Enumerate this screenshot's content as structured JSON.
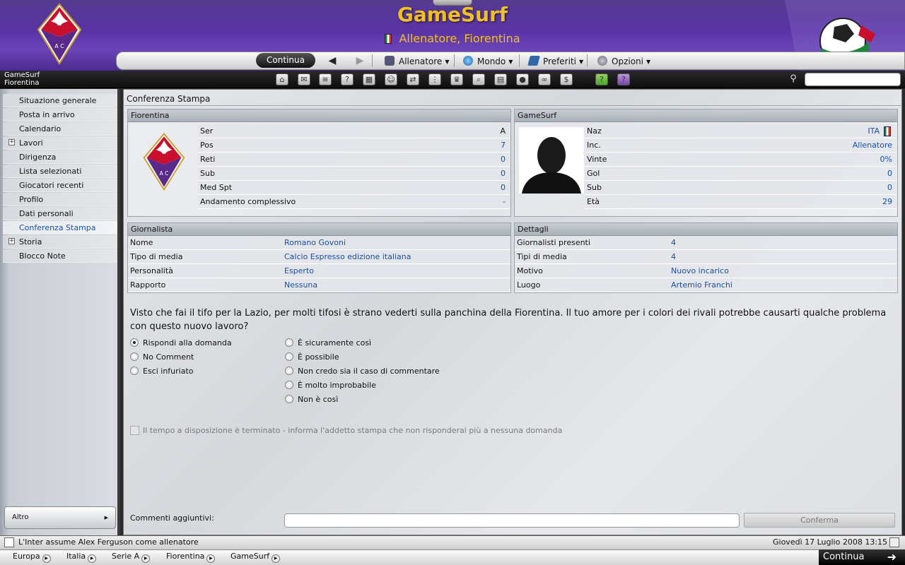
{
  "app": {
    "title": "GameSurf",
    "subtitle": "Allenatore, Fiorentina"
  },
  "nav": {
    "continue_label": "Continua",
    "back_icon": "back-arrow-icon",
    "forward_icon": "forward-arrow-icon",
    "menus": [
      "Allenatore",
      "Mondo",
      "Preferiti",
      "Opzioni"
    ]
  },
  "toolbar": {
    "user": "GameSurf",
    "club": "Fiorentina"
  },
  "sidebar": {
    "items": [
      {
        "label": "Situazione generale"
      },
      {
        "label": "Posta in arrivo"
      },
      {
        "label": "Calendario"
      },
      {
        "label": "Lavori"
      },
      {
        "label": "Dirigenza"
      },
      {
        "label": "Lista selezionati"
      },
      {
        "label": "Giocatori recenti"
      },
      {
        "label": "Profilo"
      },
      {
        "label": "Dati personali"
      },
      {
        "label": "Conferenza Stampa"
      },
      {
        "label": "Storia"
      },
      {
        "label": "Blocco Note"
      }
    ],
    "altro": "Altro"
  },
  "main": {
    "title": "Conferenza Stampa",
    "club_panel": {
      "header": "Fiorentina",
      "rows": [
        {
          "label": "Ser",
          "value": "A"
        },
        {
          "label": "Pos",
          "value": "7"
        },
        {
          "label": "Reti",
          "value": "0"
        },
        {
          "label": "Sub",
          "value": "0"
        },
        {
          "label": "Med Spt",
          "value": "0"
        },
        {
          "label": "Andamento complessivo",
          "value": "-"
        }
      ]
    },
    "manager_panel": {
      "header": "GameSurf",
      "rows": [
        {
          "label": "Naz",
          "value": "ITA"
        },
        {
          "label": "Inc.",
          "value": "Allenatore"
        },
        {
          "label": "Vinte",
          "value": "0%"
        },
        {
          "label": "Gol",
          "value": "0"
        },
        {
          "label": "Sub",
          "value": "0"
        },
        {
          "label": "Età",
          "value": "29"
        }
      ]
    },
    "journalist_panel": {
      "header": "Giornalista",
      "rows": [
        {
          "label": "Nome",
          "value": "Romano Govoni"
        },
        {
          "label": "Tipo di media",
          "value": "Calcio Espresso edizione italiana"
        },
        {
          "label": "Personalità",
          "value": "Esperto"
        },
        {
          "label": "Rapporto",
          "value": "Nessuna"
        }
      ]
    },
    "details_panel": {
      "header": "Dettagli",
      "rows": [
        {
          "label": "Giornalisti presenti",
          "value": "4"
        },
        {
          "label": "Tipi di media",
          "value": "4"
        },
        {
          "label": "Motivo",
          "value": "Nuovo incarico"
        },
        {
          "label": "Luogo",
          "value": "Artemio Franchi"
        }
      ]
    },
    "question": "Visto che fai il tifo per la Lazio, per molti tifosi è strano vederti sulla panchina della Fiorentina. Il tuo amore per i colori dei rivali potrebbe causarti qualche problema con questo nuovo lavoro?",
    "response_types": [
      {
        "label": "Rispondi alla domanda",
        "selected": true
      },
      {
        "label": "No Comment",
        "selected": false
      },
      {
        "label": "Esci infuriato",
        "selected": false
      }
    ],
    "answers": [
      {
        "label": "È sicuramente così",
        "selected": false
      },
      {
        "label": "È possibile",
        "selected": false
      },
      {
        "label": "Non credo sia il caso di commentare",
        "selected": false
      },
      {
        "label": "È molto improbabile",
        "selected": false
      },
      {
        "label": "Non è così",
        "selected": false
      }
    ],
    "timeout_label": "Il tempo a disposizione è terminato - informa l'addetto stampa che non risponderai più a nessuna domanda",
    "comments_label": "Commenti aggiuntivi:",
    "comments_value": "",
    "confirm_label": "Conferma"
  },
  "status": {
    "news": "L'Inter assume Alex Ferguson come allenatore",
    "datetime": "Giovedì 17 Luglio 2008 13:15"
  },
  "breadcrumbs": [
    "Europa",
    "Italia",
    "Serie A",
    "Fiorentina",
    "GameSurf"
  ],
  "bottom_continue": "Continua",
  "colors": {
    "header_purple": "#5a33a6",
    "title_gold": "#f0c020",
    "link_blue": "#1a4fa0"
  }
}
